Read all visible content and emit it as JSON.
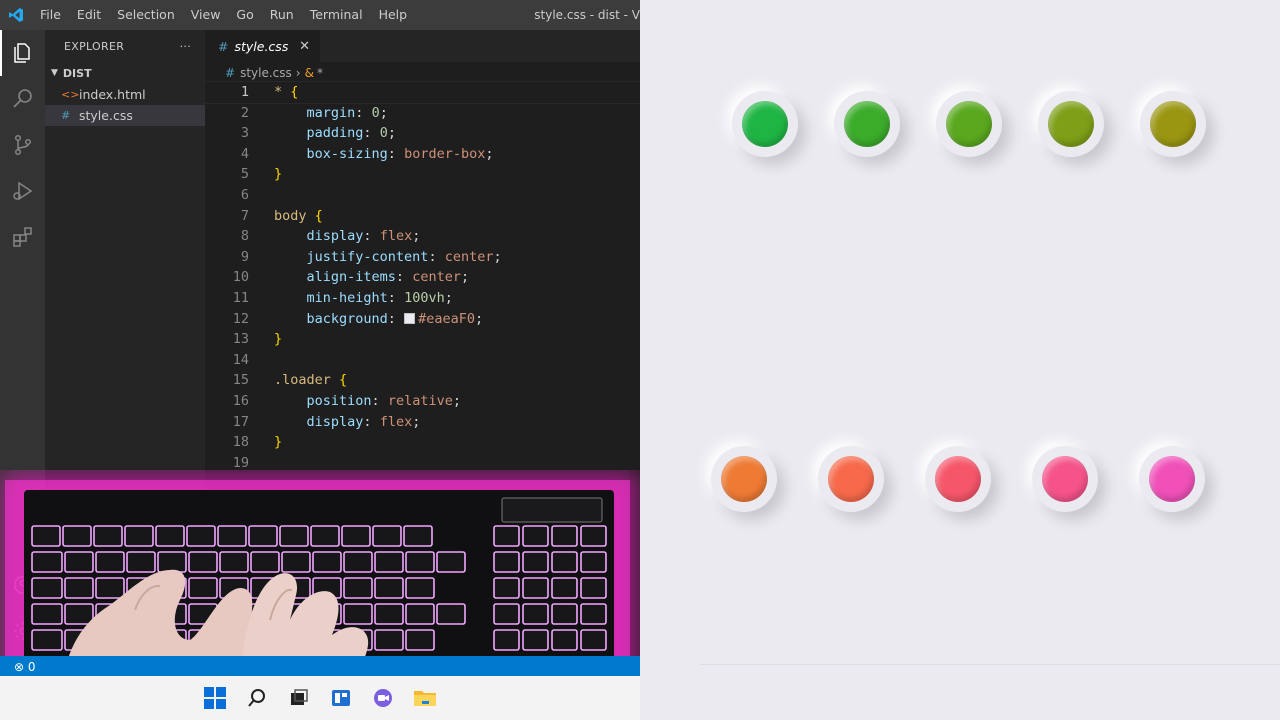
{
  "vscode": {
    "menu": [
      "File",
      "Edit",
      "Selection",
      "View",
      "Go",
      "Run",
      "Terminal",
      "Help"
    ],
    "window_title": "style.css - dist - V",
    "explorer": {
      "header": "EXPLORER",
      "more": "···",
      "folder": "DIST",
      "files": [
        {
          "name": "index.html",
          "icon": "<>"
        },
        {
          "name": "style.css",
          "icon": "#"
        }
      ]
    },
    "tab": {
      "label": "style.css",
      "icon": "#",
      "close": "✕"
    },
    "breadcrumb": {
      "file": "style.css",
      "symbol": "*"
    },
    "code_lines": [
      {
        "n": "1",
        "parts": [
          [
            "sel",
            "* "
          ],
          [
            "brace",
            "{"
          ]
        ]
      },
      {
        "n": "2",
        "parts": [
          [
            "punc",
            "    "
          ],
          [
            "prop",
            "margin"
          ],
          [
            "punc",
            ": "
          ],
          [
            "num",
            "0"
          ],
          [
            "punc",
            ";"
          ]
        ]
      },
      {
        "n": "3",
        "parts": [
          [
            "punc",
            "    "
          ],
          [
            "prop",
            "padding"
          ],
          [
            "punc",
            ": "
          ],
          [
            "num",
            "0"
          ],
          [
            "punc",
            ";"
          ]
        ]
      },
      {
        "n": "4",
        "parts": [
          [
            "punc",
            "    "
          ],
          [
            "prop",
            "box-sizing"
          ],
          [
            "punc",
            ": "
          ],
          [
            "val",
            "border-box"
          ],
          [
            "punc",
            ";"
          ]
        ]
      },
      {
        "n": "5",
        "parts": [
          [
            "brace",
            "}"
          ]
        ]
      },
      {
        "n": "6",
        "parts": []
      },
      {
        "n": "7",
        "parts": [
          [
            "sel",
            "body "
          ],
          [
            "brace",
            "{"
          ]
        ]
      },
      {
        "n": "8",
        "parts": [
          [
            "punc",
            "    "
          ],
          [
            "prop",
            "display"
          ],
          [
            "punc",
            ": "
          ],
          [
            "val",
            "flex"
          ],
          [
            "punc",
            ";"
          ]
        ]
      },
      {
        "n": "9",
        "parts": [
          [
            "punc",
            "    "
          ],
          [
            "prop",
            "justify-content"
          ],
          [
            "punc",
            ": "
          ],
          [
            "val",
            "center"
          ],
          [
            "punc",
            ";"
          ]
        ]
      },
      {
        "n": "10",
        "parts": [
          [
            "punc",
            "    "
          ],
          [
            "prop",
            "align-items"
          ],
          [
            "punc",
            ": "
          ],
          [
            "val",
            "center"
          ],
          [
            "punc",
            ";"
          ]
        ]
      },
      {
        "n": "11",
        "parts": [
          [
            "punc",
            "    "
          ],
          [
            "prop",
            "min-height"
          ],
          [
            "punc",
            ": "
          ],
          [
            "num",
            "100vh"
          ],
          [
            "punc",
            ";"
          ]
        ]
      },
      {
        "n": "12",
        "parts": [
          [
            "punc",
            "    "
          ],
          [
            "prop",
            "background"
          ],
          [
            "punc",
            ": "
          ],
          [
            "swatch",
            ""
          ],
          [
            "val",
            "#eaeaF0"
          ],
          [
            "punc",
            ";"
          ]
        ]
      },
      {
        "n": "13",
        "parts": [
          [
            "brace",
            "}"
          ]
        ]
      },
      {
        "n": "14",
        "parts": []
      },
      {
        "n": "15",
        "parts": [
          [
            "sel",
            ".loader "
          ],
          [
            "brace",
            "{"
          ]
        ]
      },
      {
        "n": "16",
        "parts": [
          [
            "punc",
            "    "
          ],
          [
            "prop",
            "position"
          ],
          [
            "punc",
            ": "
          ],
          [
            "val",
            "relative"
          ],
          [
            "punc",
            ";"
          ]
        ]
      },
      {
        "n": "17",
        "parts": [
          [
            "punc",
            "    "
          ],
          [
            "prop",
            "display"
          ],
          [
            "punc",
            ": "
          ],
          [
            "val",
            "flex"
          ],
          [
            "punc",
            ";"
          ]
        ]
      },
      {
        "n": "18",
        "parts": [
          [
            "brace",
            "}"
          ]
        ]
      },
      {
        "n": "19",
        "parts": []
      }
    ],
    "status": "⊗ 0"
  },
  "preview": {
    "background": "#eaeaf0",
    "row_top": [
      "#1fb544",
      "#3bab2a",
      "#5aa81e",
      "#7e9f17",
      "#9a9612"
    ],
    "row_bottom": [
      "#ee7a34",
      "#f7694a",
      "#f6566a",
      "#f5538a",
      "#f050b8"
    ]
  },
  "colors": {
    "activity_bar": "#333333",
    "sidebar": "#252526",
    "editor": "#1e1e1e",
    "status_bar": "#007acc",
    "keyboard_glow": "#ff1fd0"
  }
}
